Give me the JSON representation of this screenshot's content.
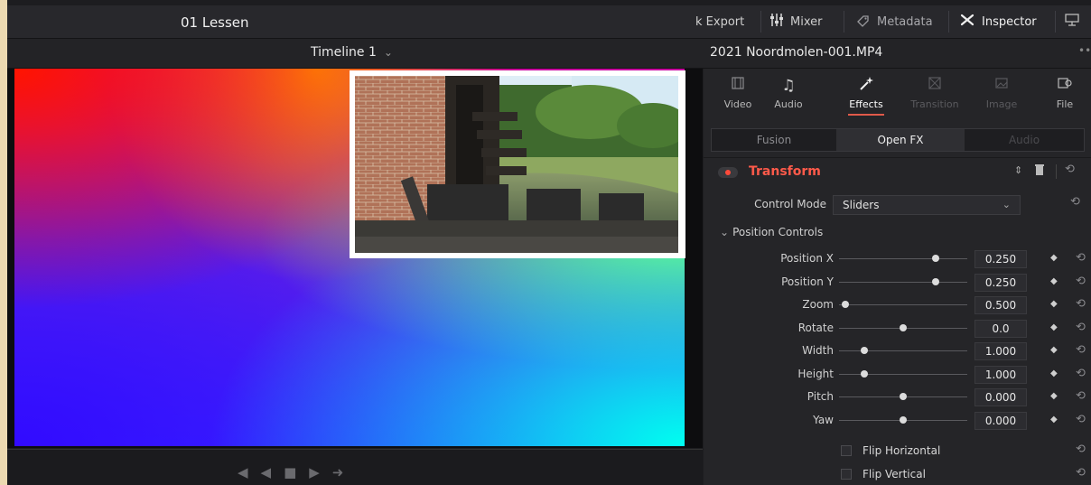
{
  "app": {
    "project_title": "01 Lessen",
    "toolbar": {
      "export_label": "k Export",
      "mixer_label": "Mixer",
      "metadata_label": "Metadata",
      "inspector_label": "Inspector"
    },
    "timeline_name": "Timeline 1",
    "clip_name": "2021 Noordmolen-001.MP4"
  },
  "inspector": {
    "tabs": [
      {
        "label": "Video",
        "icon": "film-icon",
        "state": "normal"
      },
      {
        "label": "Audio",
        "icon": "music-note-icon",
        "state": "normal"
      },
      {
        "label": "Effects",
        "icon": "magic-wand-icon",
        "state": "active"
      },
      {
        "label": "Transition",
        "icon": "transition-icon",
        "state": "disabled"
      },
      {
        "label": "Image",
        "icon": "image-icon",
        "state": "disabled"
      },
      {
        "label": "File",
        "icon": "file-icon",
        "state": "normal"
      }
    ],
    "subtabs": [
      {
        "label": "Fusion",
        "state": "normal"
      },
      {
        "label": "Open FX",
        "state": "active"
      },
      {
        "label": "Audio",
        "state": "disabled"
      }
    ],
    "effect": {
      "name": "Transform",
      "enabled": true,
      "control_mode_label": "Control Mode",
      "control_mode_value": "Sliders",
      "section_label": "Position Controls",
      "params": [
        {
          "label": "Position X",
          "value": "0.250",
          "slider": 0.75
        },
        {
          "label": "Position Y",
          "value": "0.250",
          "slider": 0.75
        },
        {
          "label": "Zoom",
          "value": "0.500",
          "slider": 0.05
        },
        {
          "label": "Rotate",
          "value": "0.0",
          "slider": 0.5
        },
        {
          "label": "Width",
          "value": "1.000",
          "slider": 0.2
        },
        {
          "label": "Height",
          "value": "1.000",
          "slider": 0.2
        },
        {
          "label": "Pitch",
          "value": "0.000",
          "slider": 0.5
        },
        {
          "label": "Yaw",
          "value": "0.000",
          "slider": 0.5
        }
      ],
      "checkboxes": [
        {
          "label": "Flip Horizontal",
          "checked": false
        },
        {
          "label": "Flip Vertical",
          "checked": false
        }
      ]
    }
  },
  "colors": {
    "accent_red": "#ff5a4a",
    "panel_bg": "#252528",
    "app_bg": "#1d1d20"
  }
}
